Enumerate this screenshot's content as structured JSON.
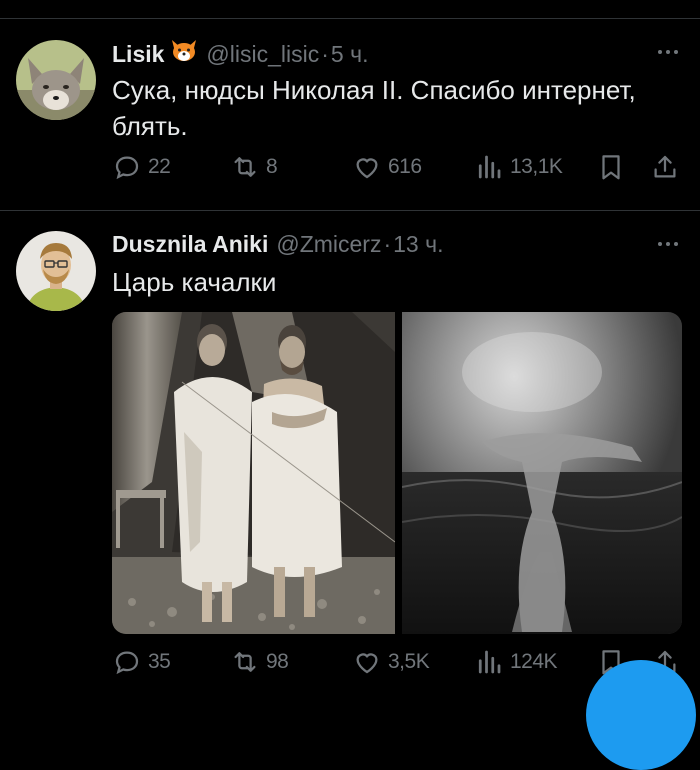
{
  "tweets": [
    {
      "name": "Lisik",
      "emoji": "fox-emoji",
      "handle": "@lisic_lisic",
      "separator": "·",
      "time": "5 ч.",
      "text_line1": "Сука, нюдсы Николая II. Спасибо интернет,",
      "text_line2": "блять.",
      "replies": "22",
      "reposts": "8",
      "likes": "616",
      "views": "13,1K"
    },
    {
      "name": "Dusznila Aniki",
      "handle": "@Zmicerz",
      "separator": "·",
      "time": "13 ч.",
      "text_line1": "Царь качалки",
      "replies": "35",
      "reposts": "98",
      "likes": "3,5K",
      "views": "124K"
    }
  ],
  "colors": {
    "background": "#000000",
    "text": "#e7e9ea",
    "muted": "#71767b",
    "divider": "#2f3336",
    "accent": "#1d9bf0"
  }
}
